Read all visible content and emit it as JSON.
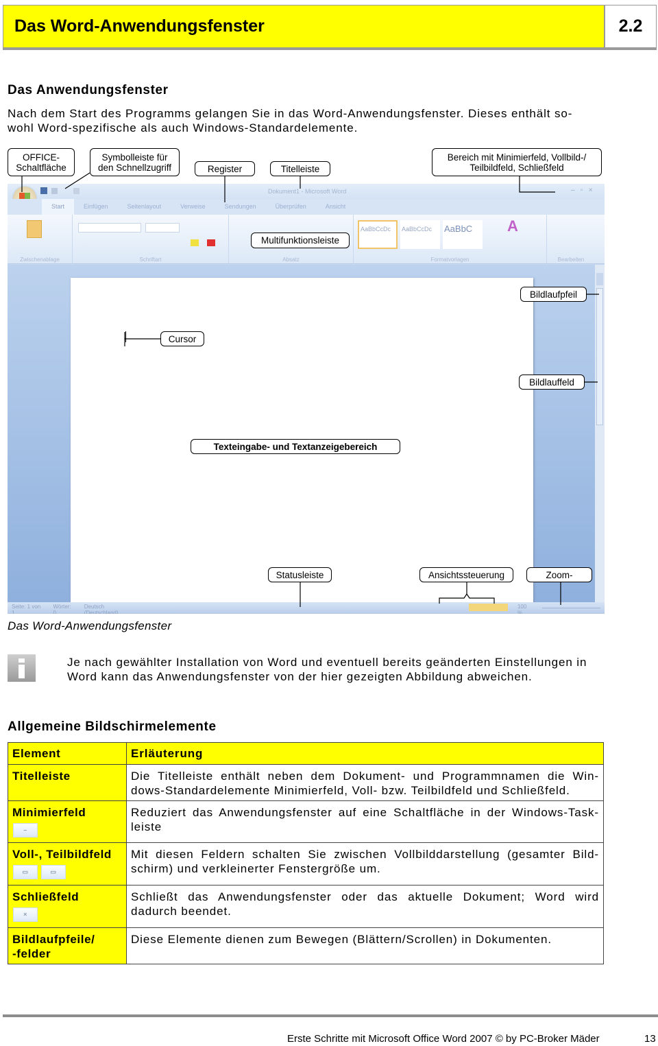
{
  "header": {
    "title": "Das Word-Anwendungsfenster",
    "section": "2.2"
  },
  "section1": {
    "heading": "Das Anwendungsfenster",
    "text_line1": "Nach dem Start des Programms gelangen Sie in das Word-Anwendungsfenster. Dieses enthält so-",
    "text_line2": "wohl Word-spezifische als auch Windows-Standardelemente."
  },
  "screenshot": {
    "title": "Dokument1 - Microsoft Word",
    "tabs": [
      "Start",
      "Einfügen",
      "Seitenlayout",
      "Verweise",
      "Sendungen",
      "Überprüfen",
      "Ansicht"
    ],
    "groups": [
      "Zwischenablage",
      "Schriftart",
      "Absatz",
      "Formatvorlagen",
      "Bearbeiten"
    ],
    "styles": [
      "AaBbCcDc",
      "AaBbCcDc",
      "AaBbC"
    ],
    "status": [
      "Seite: 1 von 1",
      "Wörter: 0",
      "Deutsch (Deutschland)"
    ],
    "zoom": "100 %",
    "colors": {
      "frame": "#c6d9f1",
      "page": "#ffffff"
    }
  },
  "callouts": {
    "office": "OFFICE-\nSchaltfläche",
    "office_l1": "OFFICE-",
    "office_l2": "Schaltfläche",
    "quick_l1": "Symbolleiste für",
    "quick_l2": "den Schnellzugriff",
    "register": "Register",
    "titlebar": "Titelleiste",
    "window_l1": "Bereich mit Minimierfeld, Vollbild-/",
    "window_l2": "Teilbildfeld, Schließfeld",
    "ribbon": "Multifunktionsleiste",
    "scroll_arrow": "Bildlaufpfeil",
    "cursor": "Cursor",
    "scroll_field": "Bildlauffeld",
    "text_area": "Texteingabe- und Textanzeigebereich",
    "statusbar": "Statusleiste",
    "view": "Ansichtssteuerung",
    "zoom": "Zoom-"
  },
  "caption": "Das Word-Anwendungsfenster",
  "info": {
    "icon": "info-icon",
    "line1": "Je nach gewählter Installation von Word und eventuell bereits geänderten Einstellungen in",
    "line2": "Word kann das Anwendungsfenster von der hier gezeigten Abbildung abweichen."
  },
  "section2": {
    "heading": "Allgemeine Bildschirmelemente"
  },
  "table": {
    "headers": [
      "Element",
      "Erläuterung"
    ],
    "rows": [
      {
        "element": "Titelleiste",
        "text": "Die Titelleiste enthält neben dem Dokument- und Programmnamen die Win-dows-Standardelemente Minimierfeld, Voll- bzw. Teilbildfeld und Schließfeld."
      },
      {
        "element": "Minimierfeld",
        "text": "Reduziert das Anwendungsfenster auf eine Schaltfläche in der Windows-Task-leiste",
        "icons": [
          "minimize-icon"
        ]
      },
      {
        "element": "Voll-, Teilbildfeld",
        "text": "Mit diesen Feldern schalten Sie zwischen Vollbilddarstellung (gesamter Bild-schirm) und verkleinerter Fenstergröße um.",
        "icons": [
          "maximize-icon",
          "restore-icon"
        ]
      },
      {
        "element": "Schließfeld",
        "text": "Schließt das Anwendungsfenster oder das aktuelle Dokument; Word wird dadurch beendet.",
        "icons": [
          "close-icon"
        ]
      },
      {
        "element_l1": "Bildlaufpfeile/",
        "element_l2": "-felder",
        "text": "Diese Elemente dienen zum Bewegen (Blättern/Scrollen) in Dokumenten."
      }
    ],
    "colors": {
      "highlight": "#ffff00"
    }
  },
  "footer": {
    "text": "Erste Schritte mit Microsoft Office Word 2007 © by PC-Broker Mäder",
    "page": "13"
  }
}
